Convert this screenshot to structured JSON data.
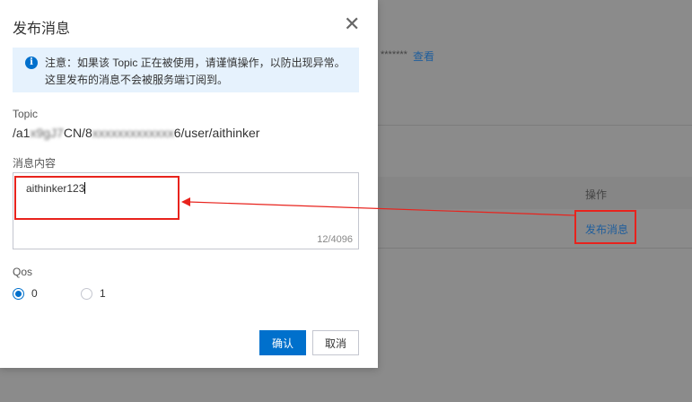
{
  "background": {
    "secret_mask": "*******",
    "view_link": "查看",
    "table_header_action": "操作",
    "publish_link": "发布消息"
  },
  "dialog": {
    "title": "发布消息",
    "notice": "注意：如果该 Topic 正在被使用，请谨慎操作，以防出现异常。这里发布的消息不会被服务端订阅到。",
    "topic_label": "Topic",
    "topic_prefix": "/a1",
    "topic_blur1": "x9gJ7",
    "topic_mid": "CN/8",
    "topic_blur2": "xxxxxxxxxxxxx",
    "topic_suffix": "6/user/aithinker",
    "content_label": "消息内容",
    "content_value": "aithinker123",
    "char_count": "12/4096",
    "qos_label": "Qos",
    "qos_options": [
      "0",
      "1"
    ],
    "qos_selected": "0",
    "confirm": "确认",
    "cancel": "取消"
  },
  "colors": {
    "primary": "#0070cc",
    "annotation": "#e8231d"
  }
}
